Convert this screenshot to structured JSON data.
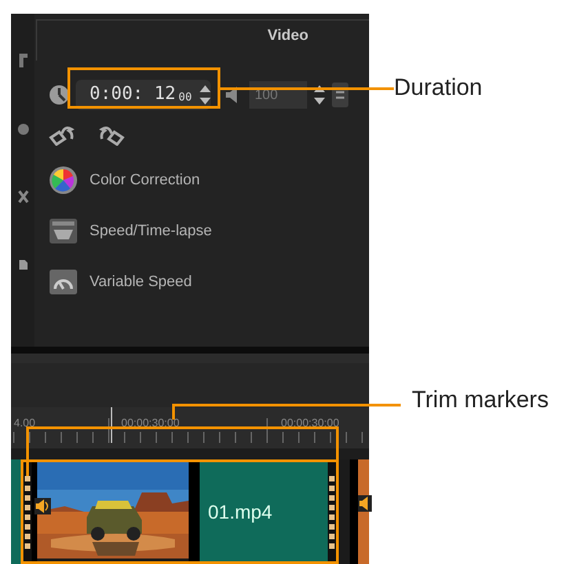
{
  "panel": {
    "title": "Video",
    "duration": {
      "value": "0:00: 12",
      "frames": "00"
    },
    "volume": {
      "value": "100"
    },
    "options": [
      {
        "label": "Color Correction",
        "kind": "color"
      },
      {
        "label": "Speed/Time-lapse",
        "kind": "speed"
      },
      {
        "label": "Variable Speed",
        "kind": "variable"
      }
    ]
  },
  "timeline": {
    "ruler_labels": [
      "4.00",
      "00:00:30:00",
      "00:00:30:00"
    ],
    "clips": [
      {
        "name": "01.mp4",
        "selected": true
      }
    ]
  },
  "callouts": [
    {
      "label": "Duration"
    },
    {
      "label": "Trim markers"
    }
  ]
}
